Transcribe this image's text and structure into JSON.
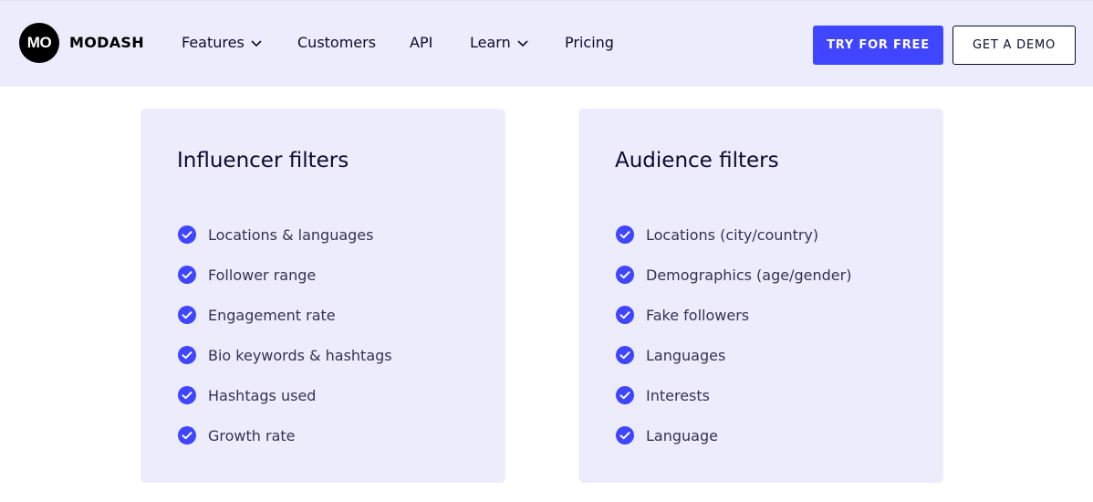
{
  "brand": {
    "logo_mark": "MO",
    "name": "MODASH"
  },
  "nav": {
    "items": [
      {
        "label": "Features",
        "has_dropdown": true
      },
      {
        "label": "Customers",
        "has_dropdown": false
      },
      {
        "label": "API",
        "has_dropdown": false
      },
      {
        "label": "Learn",
        "has_dropdown": true
      },
      {
        "label": "Pricing",
        "has_dropdown": false
      }
    ],
    "cta_primary": "TRY FOR FREE",
    "cta_secondary": "GET A DEMO"
  },
  "cards": [
    {
      "title": "Influencer filters",
      "items": [
        "Locations & languages",
        "Follower range",
        "Engagement rate",
        "Bio keywords & hashtags",
        "Hashtags used",
        "Growth rate"
      ]
    },
    {
      "title": "Audience filters",
      "items": [
        "Locations (city/country)",
        "Demographics (age/gender)",
        "Fake followers",
        "Languages",
        "Interests",
        "Language"
      ]
    }
  ],
  "colors": {
    "accent": "#4045ff",
    "panel_bg": "#ececfc",
    "text_dark": "#0b0b2b"
  },
  "icons": {
    "check": "check-circle-icon",
    "dropdown": "chevron-down-icon"
  }
}
